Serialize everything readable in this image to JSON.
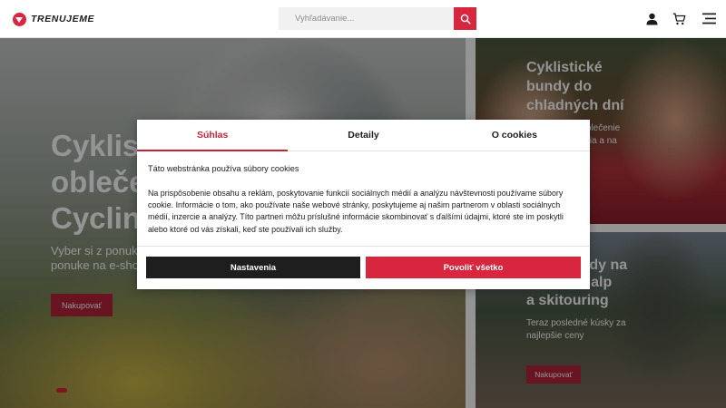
{
  "header": {
    "logo_text": "TRENUJEME",
    "search_placeholder": "Vyhľadávanie...",
    "icons": [
      "user-icon",
      "cart-icon",
      "menu-icon"
    ]
  },
  "hero": {
    "title_lines": [
      "Cyklis",
      "obleče",
      "Cyclin"
    ],
    "subtitle_lines": [
      "Vyber si z ponuky",
      "ponuke na e-sho"
    ],
    "button": "Nakupovať"
  },
  "card_top": {
    "title_lines": [
      "Cyklistické",
      "bundy do",
      "chladných dní"
    ],
    "text_lines": [
      "cké oblečenie",
      "obdobia a na"
    ]
  },
  "card_bottom": {
    "title_lines": [
      "bundy na",
      ", skialp",
      "a skitouring"
    ],
    "text_lines": [
      "Teraz posledné kúsky za",
      "najlepšie ceny"
    ],
    "button": "Nakupovať"
  },
  "cookie_dialog": {
    "tabs": [
      "Súhlas",
      "Detaily",
      "O cookies"
    ],
    "active_tab": "Súhlas",
    "heading": "Táto webstránka používa súbory cookies",
    "body": "Na prispôsobenie obsahu a reklám, poskytovanie funkcií sociálnych médií a analýzu návštevnosti používame súbory cookie. Informácie o tom, ako používate naše webové stránky, poskytujeme aj našim partnerom v oblasti sociálnych médií, inzercie a analýzy. Títo partneri môžu príslušné informácie skombinovať s ďalšími údajmi, ktoré ste im poskytli alebo ktoré od vás získali, keď ste používali ich služby.",
    "button_settings": "Nastavenia",
    "button_allow_all": "Povoliť všetko"
  },
  "colors": {
    "brand_red": "#d7263d",
    "dark_button": "#1e1e1e"
  }
}
